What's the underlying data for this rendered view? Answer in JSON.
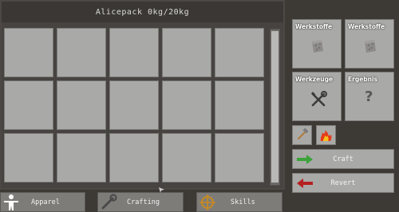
{
  "inventory": {
    "title": "Alicepack 0kg/20kg",
    "rows": 3,
    "cols": 5
  },
  "crafting": {
    "slot1_label": "Werkstoffe",
    "slot2_label": "Werkstoffe",
    "slot3_label": "Werkzeuge",
    "slot4_label": "Ergebnis",
    "result_placeholder": "?",
    "craft_label": "Craft",
    "revert_label": "Revert",
    "craft_arrow_color": "#3aa33a",
    "revert_arrow_color": "#b52020"
  },
  "tabs": {
    "apparel": "Apparel",
    "crafting": "Crafting",
    "skills": "Skills"
  },
  "icons": {
    "material": "stone-block-icon",
    "tools": "wrench-screwdriver-icon",
    "hammer": "hammer-icon",
    "fire": "fire-icon",
    "apparel": "person-icon",
    "crafting": "wrench-icon",
    "skills": "target-icon"
  }
}
